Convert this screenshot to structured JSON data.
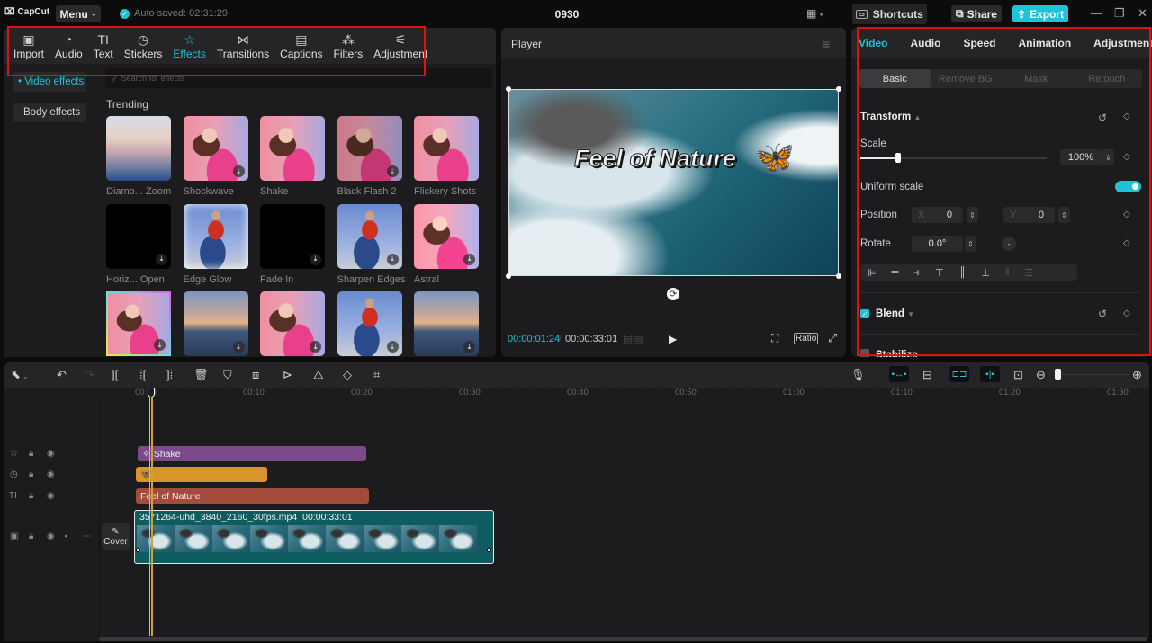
{
  "app": {
    "logo": "CapCut",
    "menu_label": "Menu",
    "autosave": "Auto saved: 02:31:29",
    "project_title": "0930",
    "shortcuts_label": "Shortcuts",
    "share_label": "Share",
    "export_label": "Export",
    "accent": "#1ec3d6"
  },
  "media_toolbar": {
    "tabs": [
      {
        "label": "Import",
        "icon": "import-icon",
        "glyph": "▣"
      },
      {
        "label": "Audio",
        "icon": "audio-icon",
        "glyph": "◔"
      },
      {
        "label": "Text",
        "icon": "text-icon",
        "glyph": "TI"
      },
      {
        "label": "Stickers",
        "icon": "stickers-icon",
        "glyph": "◷"
      },
      {
        "label": "Effects",
        "icon": "effects-icon",
        "glyph": "☆",
        "active": true
      },
      {
        "label": "Transitions",
        "icon": "transitions-icon",
        "glyph": "⋈"
      },
      {
        "label": "Captions",
        "icon": "captions-icon",
        "glyph": "▤"
      },
      {
        "label": "Filters",
        "icon": "filters-icon",
        "glyph": "⁂"
      },
      {
        "label": "Adjustment",
        "icon": "adjustment-icon",
        "glyph": "⚟"
      }
    ]
  },
  "effects": {
    "side_nav": [
      {
        "label": "• Video effects",
        "active": true
      },
      {
        "label": "Body effects"
      }
    ],
    "search_placeholder": "Search for effects",
    "section": "Trending",
    "items": [
      {
        "label": "Diamo... Zoom",
        "thumb": "t-city",
        "download": false
      },
      {
        "label": "Shockwave",
        "thumb": "t-girl",
        "download": true
      },
      {
        "label": "Shake",
        "thumb": "t-girl",
        "download": false
      },
      {
        "label": "Black Flash 2",
        "thumb": "t-girl t-girl-dark",
        "download": true
      },
      {
        "label": "Flickery Shots",
        "thumb": "t-girl",
        "download": false
      },
      {
        "label": "Horiz... Open",
        "thumb": "t-black",
        "download": true
      },
      {
        "label": "Edge Glow",
        "thumb": "t-boy t-boy-glow",
        "download": false
      },
      {
        "label": "Fade In",
        "thumb": "t-black",
        "download": true
      },
      {
        "label": "Sharpen Edges",
        "thumb": "t-boy",
        "download": true
      },
      {
        "label": "Astral",
        "thumb": "t-girl t-astral",
        "download": true
      },
      {
        "label": "",
        "thumb": "t-girl t-girl-rainbow",
        "download": true
      },
      {
        "label": "",
        "thumb": "t-nyc",
        "download": true
      },
      {
        "label": "",
        "thumb": "t-girl",
        "download": true
      },
      {
        "label": "",
        "thumb": "t-boy",
        "download": true
      },
      {
        "label": "",
        "thumb": "t-nyc",
        "download": true
      }
    ]
  },
  "player": {
    "title": "Player",
    "overlay_text": "Feel of Nature",
    "sticker": "🦋",
    "current_time": "00:00:01:24",
    "total_time": "00:00:33:01",
    "ratio_label": "Ratio"
  },
  "properties": {
    "tabs": [
      {
        "label": "Video",
        "active": true
      },
      {
        "label": "Audio"
      },
      {
        "label": "Speed"
      },
      {
        "label": "Animation"
      },
      {
        "label": "Adjustment"
      }
    ],
    "subtabs": [
      {
        "label": "Basic",
        "active": true
      },
      {
        "label": "Remove BG"
      },
      {
        "label": "Mask"
      },
      {
        "label": "Retouch"
      }
    ],
    "transform_label": "Transform",
    "scale_label": "Scale",
    "scale_value": "100%",
    "scale_slider_percent": 20,
    "uniform_scale_label": "Uniform scale",
    "uniform_scale_on": true,
    "position_label": "Position",
    "position_x_label": "X",
    "position_x": "0",
    "position_y_label": "Y",
    "position_y": "0",
    "rotate_label": "Rotate",
    "rotate_value": "0.0°",
    "blend_label": "Blend",
    "blend_checked": true,
    "stabilize_label": "Stabilize"
  },
  "timeline": {
    "ruler_ticks": [
      "00:00",
      "00:10",
      "00:20",
      "00:30",
      "00:40",
      "00:50",
      "01:00",
      "01:10",
      "01:20",
      "01:30"
    ],
    "tracks": {
      "effect_clip": "Shake",
      "effect_color": "#7a4a8a",
      "sticker_clip": "🦋",
      "sticker_color": "#d9952a",
      "text_clip": "Feel of Nature",
      "text_color": "#a34b3d",
      "video_filename": "3571264-uhd_3840_2160_30fps.mp4",
      "video_duration": "00:00:33:01",
      "video_color": "#0f5c60"
    },
    "cover_label": "Cover"
  }
}
